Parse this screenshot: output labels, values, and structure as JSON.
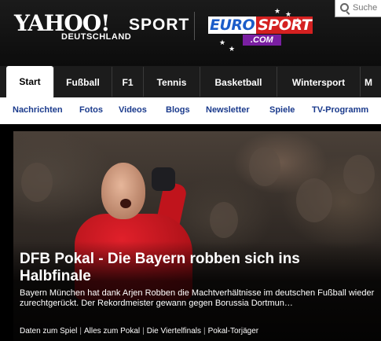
{
  "header": {
    "logo_yahoo": "YAHOO!",
    "logo_sport": "SPORT",
    "logo_sub": "DEUTSCHLAND",
    "partner_euro": "EURO",
    "partner_sport": "SPORT",
    "partner_com": ".COM",
    "search_placeholder": "Suche"
  },
  "main_nav": {
    "tabs": [
      {
        "label": "Start",
        "active": true
      },
      {
        "label": "Fußball"
      },
      {
        "label": "F1"
      },
      {
        "label": "Tennis"
      },
      {
        "label": "Basketball"
      },
      {
        "label": "Wintersport"
      },
      {
        "label": "M"
      }
    ]
  },
  "sub_nav": {
    "links": [
      "Nachrichten",
      "Fotos",
      "Videos",
      "Blogs",
      "Newsletter",
      "Spiele",
      "TV-Programm"
    ]
  },
  "hero": {
    "headline": "DFB Pokal - Die Bayern robben sich ins Halbfinale",
    "teaser": "Bayern München hat dank Arjen Robben die Machtverhältnisse im deutschen Fußball wieder zurechtgerückt. Der Rekordmeister gewann gegen Borussia Dortmun…",
    "related": [
      "Daten zum Spiel",
      "Alles zum Pokal",
      "Die Viertelfinals",
      "Pokal-Torjäger"
    ]
  },
  "colors": {
    "nav_link": "#1a3a8c",
    "eurosport_blue": "#1b5cc9",
    "eurosport_red": "#d42020",
    "eurosport_purple": "#7a1fa2"
  }
}
